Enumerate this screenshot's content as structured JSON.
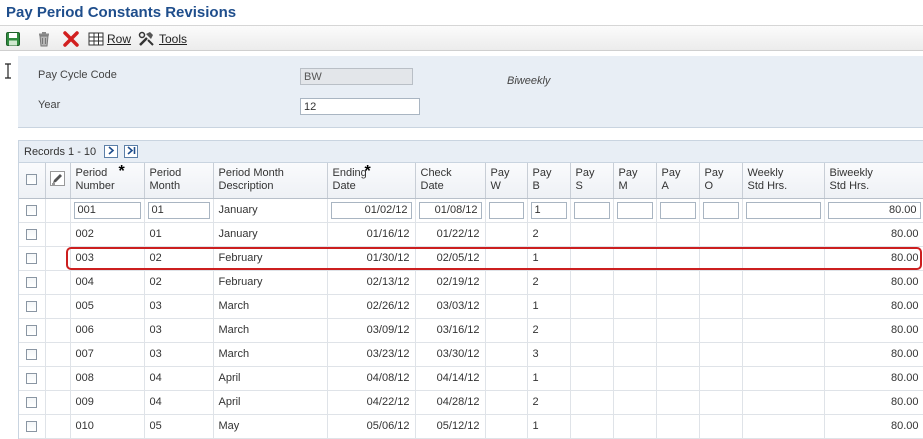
{
  "page": {
    "title": "Pay Period Constants Revisions"
  },
  "toolbar": {
    "save_icon": "save-disk-icon",
    "delete_icon": "trash-icon",
    "cancel_icon": "red-x-icon",
    "row_label": "Row",
    "tools_label": "Tools"
  },
  "header": {
    "pay_cycle_code_label": "Pay Cycle Code",
    "pay_cycle_code_value": "BW",
    "pay_cycle_desc": "Biweekly",
    "year_label": "Year",
    "year_value": "12"
  },
  "grid": {
    "records_text": "Records 1 - 10",
    "columns": {
      "period_number": [
        "Period",
        "Number"
      ],
      "period_month": [
        "Period",
        "Month"
      ],
      "month_desc": [
        "Period Month",
        "Description"
      ],
      "ending_date": [
        "Ending",
        "Date"
      ],
      "check_date": [
        "Check",
        "Date"
      ],
      "pay_w": [
        "Pay",
        "W"
      ],
      "pay_b": [
        "Pay",
        "B"
      ],
      "pay_s": [
        "Pay",
        "S"
      ],
      "pay_m": [
        "Pay",
        "M"
      ],
      "pay_a": [
        "Pay",
        "A"
      ],
      "pay_o": [
        "Pay",
        "O"
      ],
      "weekly_hrs": [
        "Weekly",
        "Std Hrs."
      ],
      "biweekly_hrs": [
        "Biweekly",
        "Std Hrs."
      ]
    },
    "rows": [
      {
        "period": "001",
        "month": "01",
        "desc": "January",
        "ending": "01/02/12",
        "check": "01/08/12",
        "pay_b": "1",
        "biweekly": "80.00"
      },
      {
        "period": "002",
        "month": "01",
        "desc": "January",
        "ending": "01/16/12",
        "check": "01/22/12",
        "pay_b": "2",
        "biweekly": "80.00"
      },
      {
        "period": "003",
        "month": "02",
        "desc": "February",
        "ending": "01/30/12",
        "check": "02/05/12",
        "pay_b": "1",
        "biweekly": "80.00"
      },
      {
        "period": "004",
        "month": "02",
        "desc": "February",
        "ending": "02/13/12",
        "check": "02/19/12",
        "pay_b": "2",
        "biweekly": "80.00"
      },
      {
        "period": "005",
        "month": "03",
        "desc": "March",
        "ending": "02/26/12",
        "check": "03/03/12",
        "pay_b": "1",
        "biweekly": "80.00"
      },
      {
        "period": "006",
        "month": "03",
        "desc": "March",
        "ending": "03/09/12",
        "check": "03/16/12",
        "pay_b": "2",
        "biweekly": "80.00"
      },
      {
        "period": "007",
        "month": "03",
        "desc": "March",
        "ending": "03/23/12",
        "check": "03/30/12",
        "pay_b": "3",
        "biweekly": "80.00"
      },
      {
        "period": "008",
        "month": "04",
        "desc": "April",
        "ending": "04/08/12",
        "check": "04/14/12",
        "pay_b": "1",
        "biweekly": "80.00"
      },
      {
        "period": "009",
        "month": "04",
        "desc": "April",
        "ending": "04/22/12",
        "check": "04/28/12",
        "pay_b": "2",
        "biweekly": "80.00"
      },
      {
        "period": "010",
        "month": "05",
        "desc": "May",
        "ending": "05/06/12",
        "check": "05/12/12",
        "pay_b": "1",
        "biweekly": "80.00"
      }
    ]
  },
  "colors": {
    "title": "#1f4e8c",
    "highlight": "#cc1f1f",
    "panel": "#e8eef5"
  }
}
